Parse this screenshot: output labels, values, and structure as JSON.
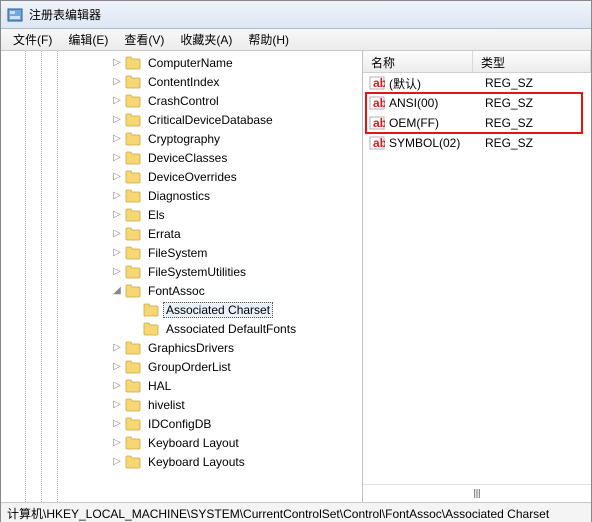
{
  "window": {
    "title": "注册表编辑器"
  },
  "menu": {
    "file": "文件(F)",
    "edit": "编辑(E)",
    "view": "查看(V)",
    "favorites": "收藏夹(A)",
    "help": "帮助(H)"
  },
  "tree": {
    "items": [
      {
        "label": "ComputerName",
        "indent": 110,
        "exp": "▷"
      },
      {
        "label": "ContentIndex",
        "indent": 110,
        "exp": "▷"
      },
      {
        "label": "CrashControl",
        "indent": 110,
        "exp": "▷"
      },
      {
        "label": "CriticalDeviceDatabase",
        "indent": 110,
        "exp": "▷"
      },
      {
        "label": "Cryptography",
        "indent": 110,
        "exp": "▷"
      },
      {
        "label": "DeviceClasses",
        "indent": 110,
        "exp": "▷"
      },
      {
        "label": "DeviceOverrides",
        "indent": 110,
        "exp": "▷"
      },
      {
        "label": "Diagnostics",
        "indent": 110,
        "exp": "▷"
      },
      {
        "label": "Els",
        "indent": 110,
        "exp": "▷"
      },
      {
        "label": "Errata",
        "indent": 110,
        "exp": "▷"
      },
      {
        "label": "FileSystem",
        "indent": 110,
        "exp": "▷"
      },
      {
        "label": "FileSystemUtilities",
        "indent": 110,
        "exp": "▷"
      },
      {
        "label": "FontAssoc",
        "indent": 110,
        "exp": "◢",
        "expanded": true
      },
      {
        "label": "Associated Charset",
        "indent": 128,
        "exp": "",
        "selected": true
      },
      {
        "label": "Associated DefaultFonts",
        "indent": 128,
        "exp": ""
      },
      {
        "label": "GraphicsDrivers",
        "indent": 110,
        "exp": "▷"
      },
      {
        "label": "GroupOrderList",
        "indent": 110,
        "exp": "▷"
      },
      {
        "label": "HAL",
        "indent": 110,
        "exp": "▷"
      },
      {
        "label": "hivelist",
        "indent": 110,
        "exp": "▷"
      },
      {
        "label": "IDConfigDB",
        "indent": 110,
        "exp": "▷"
      },
      {
        "label": "Keyboard Layout",
        "indent": 110,
        "exp": "▷"
      },
      {
        "label": "Keyboard Layouts",
        "indent": 110,
        "exp": "▷"
      }
    ]
  },
  "list": {
    "headers": {
      "name": "名称",
      "type": "类型"
    },
    "rows": [
      {
        "name": "(默认)",
        "type": "REG_SZ"
      },
      {
        "name": "ANSI(00)",
        "type": "REG_SZ"
      },
      {
        "name": "OEM(FF)",
        "type": "REG_SZ"
      },
      {
        "name": "SYMBOL(02)",
        "type": "REG_SZ"
      }
    ]
  },
  "status": {
    "path": "计算机\\HKEY_LOCAL_MACHINE\\SYSTEM\\CurrentControlSet\\Control\\FontAssoc\\Associated Charset"
  }
}
